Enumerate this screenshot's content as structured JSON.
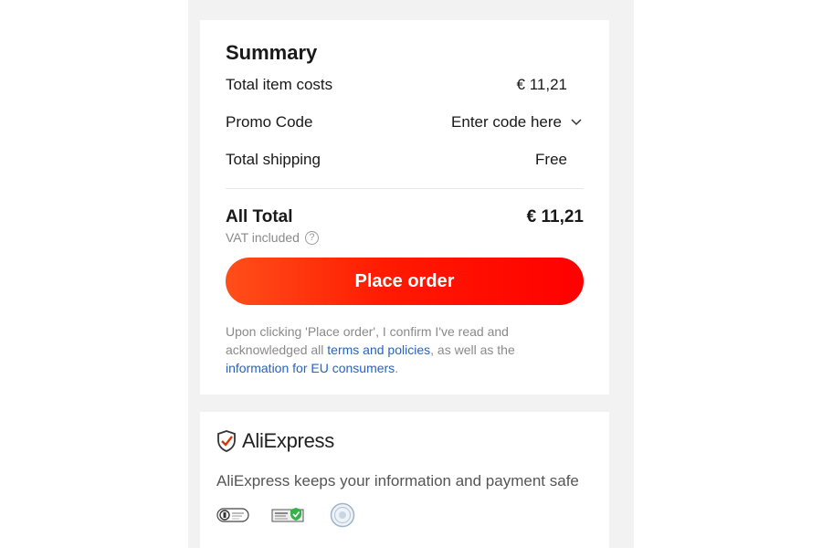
{
  "summary": {
    "title": "Summary",
    "item_costs_label": "Total item costs",
    "item_costs_value": "€ 11,21",
    "promo_label": "Promo Code",
    "promo_value": "Enter code here",
    "shipping_label": "Total shipping",
    "shipping_value": "Free",
    "all_total_label": "All Total",
    "all_total_value": "€ 11,21",
    "vat_text": "VAT included",
    "place_order_label": "Place order",
    "disclaimer_prefix": "Upon clicking 'Place order', I confirm I've read and acknowledged all ",
    "terms_link": "terms and policies",
    "disclaimer_middle": ", as well as the ",
    "eu_link": "information for EU consumers",
    "disclaimer_suffix": "."
  },
  "trust": {
    "brand": "AliExpress",
    "safe_text": "AliExpress keeps your information and payment safe",
    "badges": [
      "privacy-badge-icon",
      "secure-certificate-badge-icon",
      "verified-seal-badge-icon"
    ]
  },
  "colors": {
    "accent_start": "#ff4f1a",
    "accent_end": "#ff0000",
    "link": "#2563c9",
    "brand_red": "#e62e04"
  }
}
